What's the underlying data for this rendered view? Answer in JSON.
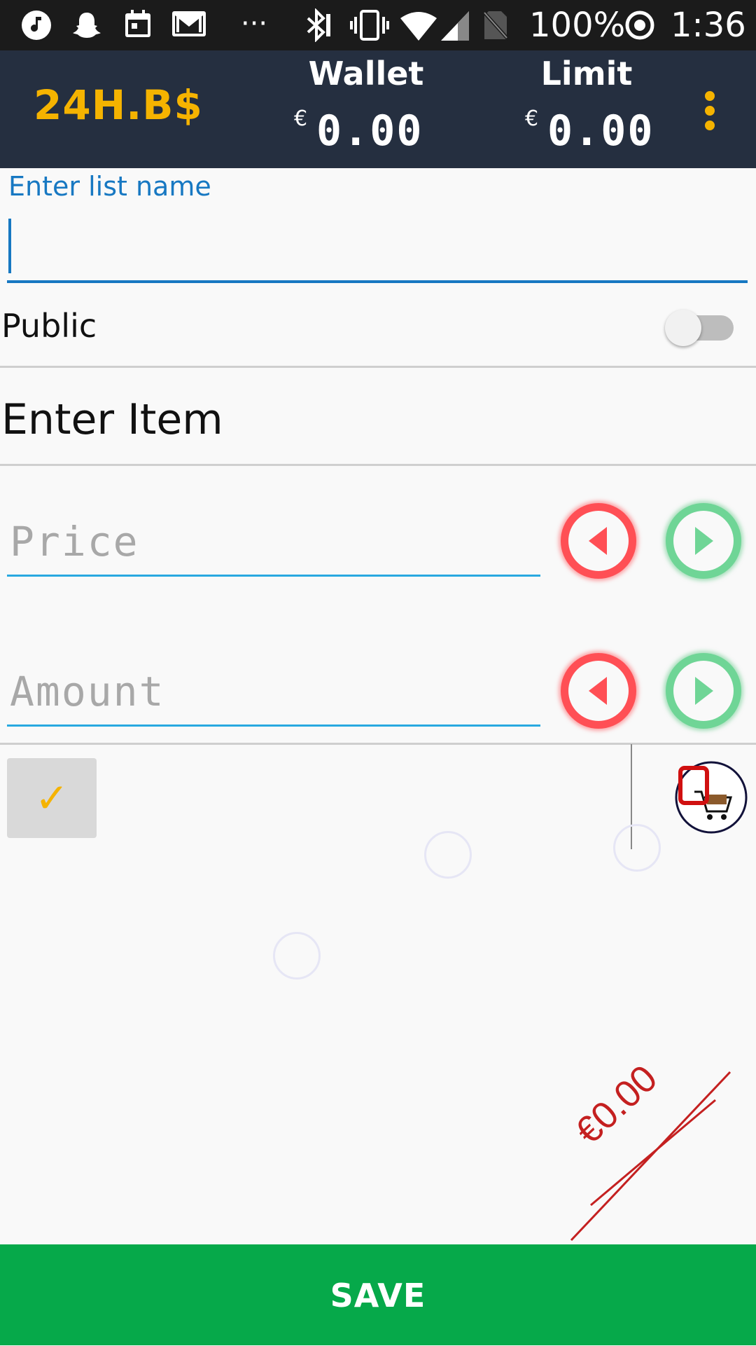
{
  "status_bar": {
    "battery": "100%",
    "time": "1:36",
    "icons": [
      "music-note-icon",
      "snapchat-icon",
      "calendar-icon",
      "mail-icon",
      "more-icon",
      "bluetooth-icon",
      "vibrate-icon",
      "wifi-icon",
      "signal-icon",
      "no-sim-icon",
      "sync-icon"
    ],
    "overflow_dots": "···"
  },
  "header": {
    "brand": "24H.B$",
    "wallet": {
      "label": "Wallet",
      "currency": "€",
      "value": "0.00"
    },
    "limit": {
      "label": "Limit",
      "currency": "€",
      "value": "0.00"
    },
    "menu_icon": "more-vert-icon"
  },
  "form": {
    "list_name_label": "Enter list name",
    "list_name_value": "",
    "public_label": "Public",
    "public_on": false,
    "enter_item_label": "Enter Item",
    "price_placeholder": "Price",
    "amount_placeholder": "Amount"
  },
  "list": {
    "check_mark": "✓",
    "cart_icon": "shopping-cart-icon"
  },
  "total": "€0.00",
  "save_label": "SAVE",
  "colors": {
    "header_bg": "#252f40",
    "brand": "#f5b300",
    "accent_blue": "#1778c2",
    "decrease_red": "#ff4f55",
    "increase_green": "#6fd596",
    "save_green": "#06a94a",
    "total_red": "#c42020"
  }
}
